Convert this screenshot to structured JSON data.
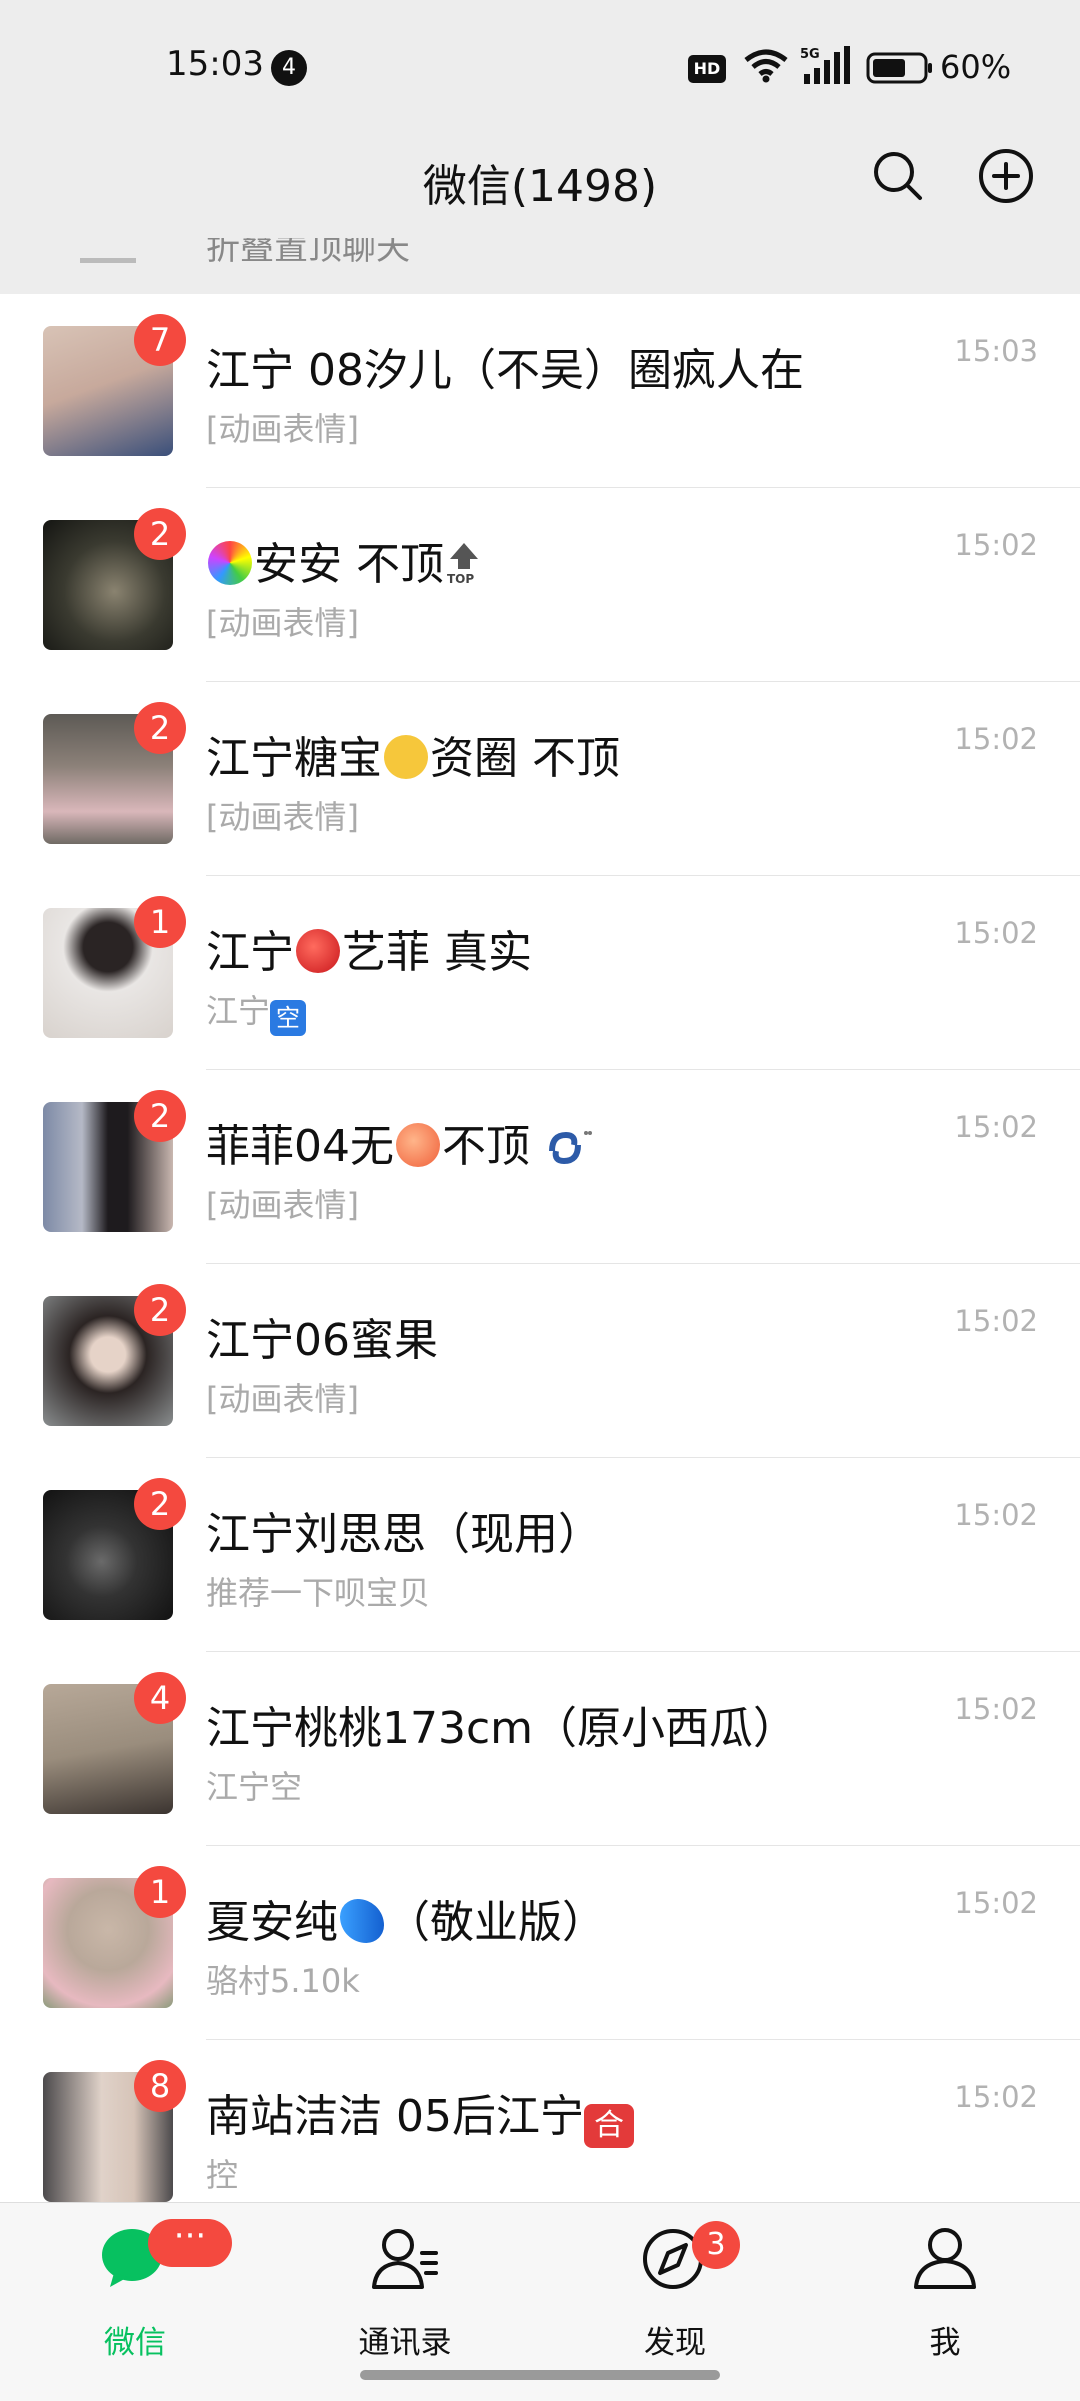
{
  "status_bar": {
    "time": "15:03",
    "notification_count": "4",
    "hd_label": "HD",
    "network": "5G",
    "battery_pct": "60%"
  },
  "header": {
    "title": "微信(1498)",
    "search_icon": "search-icon",
    "add_icon": "plus-circle-icon"
  },
  "folded": {
    "text": "折叠置顶聊天"
  },
  "chats": [
    {
      "name": "江宁 08汐儿（不吴）圈疯人在",
      "preview": "[动画表情]",
      "time": "15:03",
      "badge": "7",
      "avatar_colors": [
        "#3a4f7a",
        "#d8c3b6"
      ]
    },
    {
      "name_pre": "",
      "name_post": "安安   不顶",
      "preview": "[动画表情]",
      "time": "15:02",
      "badge": "2",
      "avatar_colors": [
        "#1d1f1b",
        "#7a7460"
      ]
    },
    {
      "name_pre": "江宁糖宝",
      "name_post": "资圈 不顶",
      "preview": "[动画表情]",
      "time": "15:02",
      "badge": "2",
      "avatar_colors": [
        "#6f6a64",
        "#d9b7ba"
      ]
    },
    {
      "name_pre": "江宁",
      "name_post": "艺菲 真实",
      "preview": "江宁",
      "preview_tag": "空",
      "time": "15:02",
      "badge": "1",
      "avatar_colors": [
        "#e9e6e4",
        "#2a2424"
      ]
    },
    {
      "name_pre": "菲菲04无",
      "name_post": "不顶",
      "preview": "[动画表情]",
      "time": "15:02",
      "badge": "2",
      "avatar_colors": [
        "#7d8aa6",
        "#1e1b1e"
      ]
    },
    {
      "name": "江宁06蜜果",
      "preview": "[动画表情]",
      "time": "15:02",
      "badge": "2",
      "avatar_colors": [
        "#8a8e8f",
        "#2b2423"
      ]
    },
    {
      "name": "江宁刘思思（现用）",
      "preview": "推荐一下呗宝贝",
      "time": "15:02",
      "badge": "2",
      "avatar_colors": [
        "#0d0d0d",
        "#5c5c5c"
      ]
    },
    {
      "name": "江宁桃桃173cm（原小西瓜）",
      "preview": "江宁空",
      "time": "15:02",
      "badge": "4",
      "avatar_colors": [
        "#9a8d7d",
        "#3b3430"
      ]
    },
    {
      "name_pre": "夏安纯",
      "name_post": "（敬业版）",
      "preview": "骆村5.10k",
      "time": "15:02",
      "badge": "1",
      "avatar_colors": [
        "#b9a89a",
        "#e7b9c0"
      ]
    },
    {
      "name_pre": "南站洁洁 05后江宁",
      "name_post": "",
      "name_tag": "合",
      "preview": "控",
      "time": "15:02",
      "badge": "8",
      "avatar_colors": [
        "#4c4a4c",
        "#e0d2c9"
      ]
    }
  ],
  "tabs": [
    {
      "label": "微信",
      "icon": "chat-bubble-icon",
      "badge": "···",
      "active": true
    },
    {
      "label": "通讯录",
      "icon": "contacts-icon",
      "badge": "",
      "active": false
    },
    {
      "label": "发现",
      "icon": "compass-icon",
      "badge": "3",
      "active": false
    },
    {
      "label": "我",
      "icon": "person-icon",
      "badge": "",
      "active": false
    }
  ],
  "colors": {
    "accent": "#07c160",
    "badge": "#f4493f",
    "bar_bg": "#ededed"
  }
}
